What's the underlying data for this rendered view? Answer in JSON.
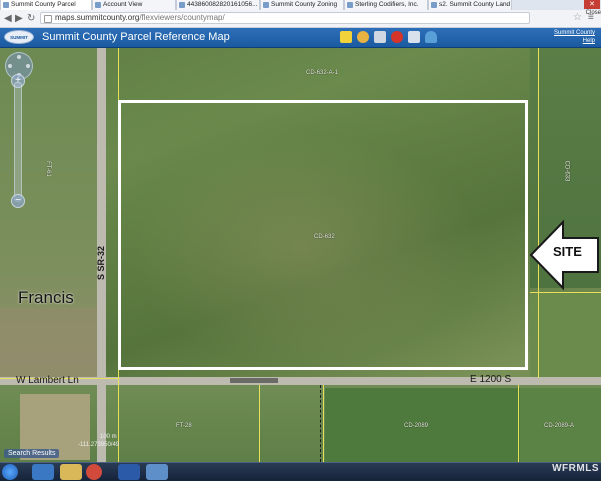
{
  "browser": {
    "tabs": [
      {
        "label": "Summit County Parcel"
      },
      {
        "label": "Account View"
      },
      {
        "label": "443860082820161056..."
      },
      {
        "label": "Summit County Zoning"
      },
      {
        "label": "Sterling Codifiers, Inc."
      },
      {
        "label": "s2. Summit County Land"
      }
    ],
    "close_tooltip": "Close",
    "url_host": "maps.summitcounty.org",
    "url_path": "/flexviewers/countymap/"
  },
  "app": {
    "logo_text": "SUMMIT",
    "title": "Summit County Parcel Reference Map",
    "links": [
      "Summit County",
      "Help"
    ]
  },
  "map": {
    "parcel_labels": [
      "CD-632-A-1",
      "CD-632",
      "CD-633",
      "FT-61",
      "FT-28",
      "CD-2089",
      "CD-2089-A"
    ],
    "road_labels": [
      "S SR-32",
      "W Lambert Ln",
      "E 1200 S"
    ],
    "place_label": "Francis",
    "site_label": "SITE",
    "scale_label": "100 m",
    "coords": "-111.273950/49",
    "search_results": "Search Results",
    "colors": {
      "site_outline": "#ffffff",
      "parcel_line": "#e6e05a",
      "road": "#bdbab0"
    }
  },
  "watermark": "WFRMLS"
}
